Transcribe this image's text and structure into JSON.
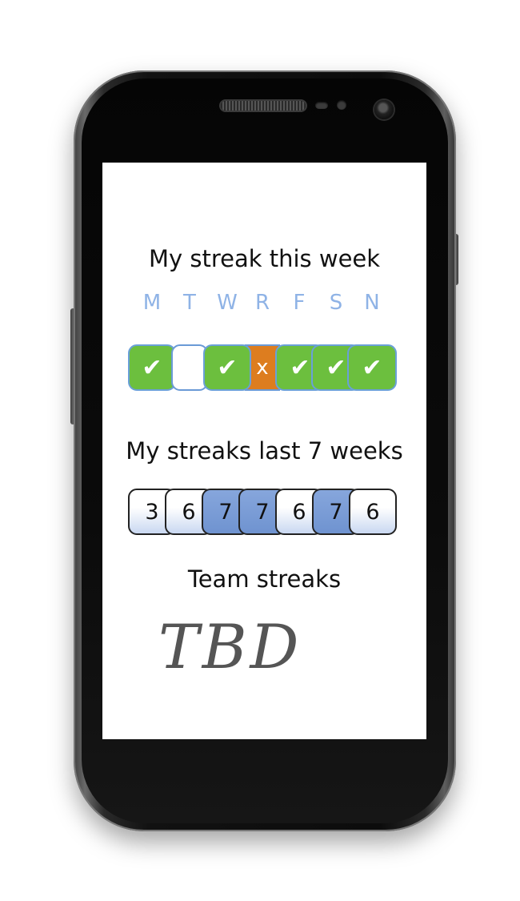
{
  "screen": {
    "this_week_title": "My streak this week",
    "days": [
      "M",
      "T",
      "W",
      "R",
      "F",
      "S",
      "N"
    ],
    "this_week": [
      {
        "status": "done",
        "mark": "✔"
      },
      {
        "status": "miss",
        "mark": ""
      },
      {
        "status": "done",
        "mark": "✔"
      },
      {
        "status": "fail",
        "mark": "x"
      },
      {
        "status": "done",
        "mark": "✔"
      },
      {
        "status": "done",
        "mark": "✔"
      },
      {
        "status": "done",
        "mark": "✔"
      }
    ],
    "last_weeks_title": "My streaks last 7 weeks",
    "last_weeks": [
      3,
      6,
      7,
      7,
      6,
      7,
      6
    ],
    "team_title": "Team streaks",
    "team_value": "TBD"
  },
  "colors": {
    "done": "#6cbf3e",
    "fail": "#dd7d1f",
    "day_label": "#8fb3e6",
    "full_week": "#6f93d0"
  }
}
